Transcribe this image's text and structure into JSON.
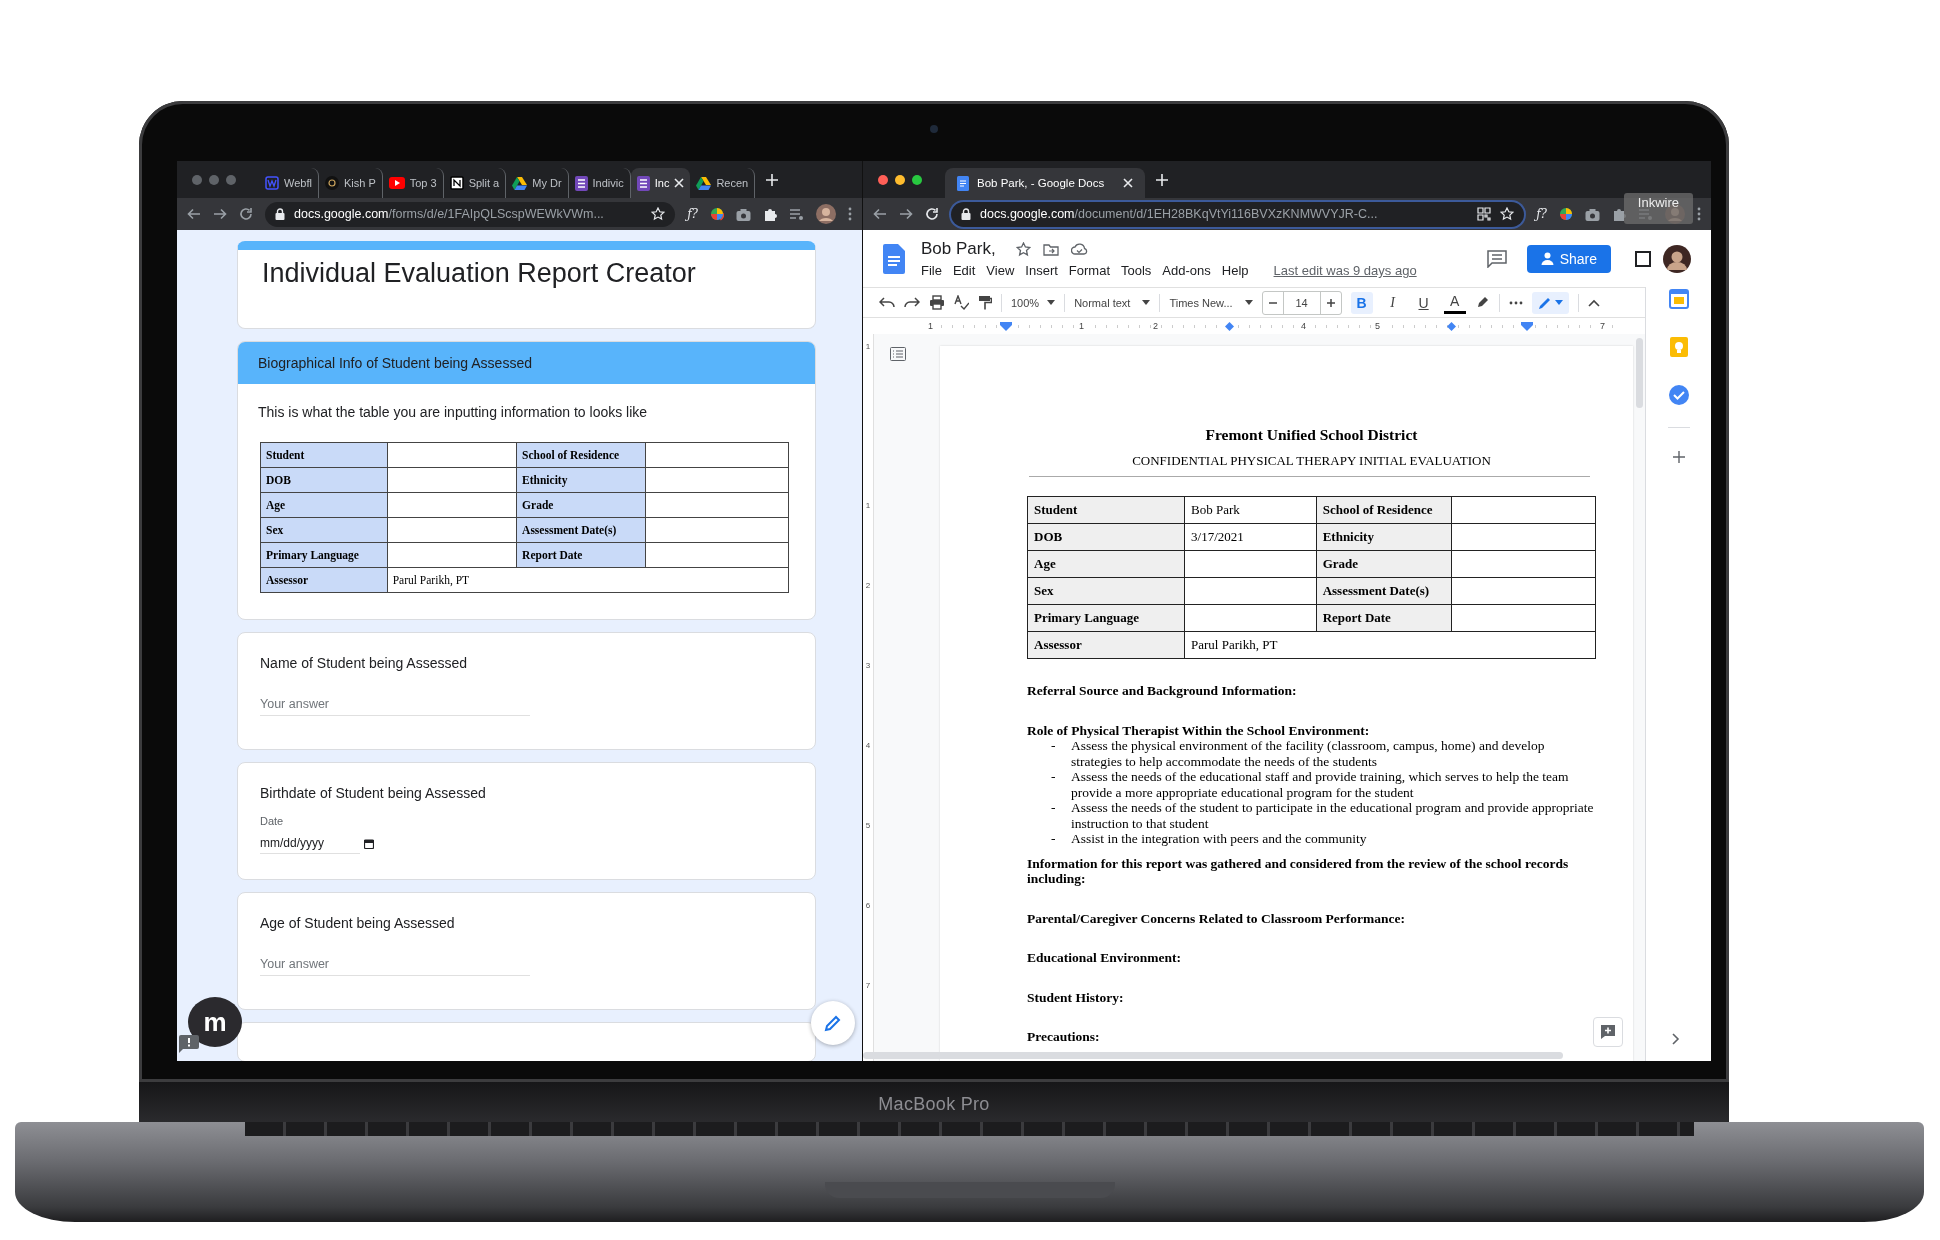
{
  "laptop": {
    "label": "MacBook Pro"
  },
  "left_browser": {
    "tabs": [
      {
        "label": "Webfl",
        "kind": "w",
        "selected": false
      },
      {
        "label": "Kish P",
        "kind": "kp",
        "selected": false
      },
      {
        "label": "Top 3",
        "kind": "youtube",
        "selected": false
      },
      {
        "label": "Split a",
        "kind": "notion",
        "selected": false
      },
      {
        "label": "My Dr",
        "kind": "drive",
        "selected": false
      },
      {
        "label": "Indivic",
        "kind": "forms",
        "selected": false
      },
      {
        "label": "Inc",
        "kind": "forms",
        "selected": true
      },
      {
        "label": "Recen",
        "kind": "drive",
        "selected": false
      }
    ],
    "url_host": "docs.google.com",
    "url_path": "/forms/d/e/1FAIpQLScspWEWkVWm...",
    "extension_label": "ƒ?"
  },
  "form": {
    "title": "Individual Evaluation Report Creator",
    "section_title": "Biographical Info of Student being Assessed",
    "description": "This is what the table you are inputting information to looks like",
    "table": [
      [
        {
          "kind": "head",
          "text": "Student"
        },
        {
          "kind": "value"
        },
        {
          "kind": "head",
          "text": "School of Residence"
        },
        {
          "kind": "value"
        }
      ],
      [
        {
          "kind": "head",
          "text": "DOB"
        },
        {
          "kind": "value"
        },
        {
          "kind": "head",
          "text": "Ethnicity"
        },
        {
          "kind": "value"
        }
      ],
      [
        {
          "kind": "head",
          "text": "Age"
        },
        {
          "kind": "value"
        },
        {
          "kind": "head",
          "text": "Grade"
        },
        {
          "kind": "value"
        }
      ],
      [
        {
          "kind": "head",
          "text": "Sex"
        },
        {
          "kind": "value"
        },
        {
          "kind": "head",
          "text": "Assessment Date(s)"
        },
        {
          "kind": "value"
        }
      ],
      [
        {
          "kind": "head",
          "text": "Primary Language"
        },
        {
          "kind": "value"
        },
        {
          "kind": "head",
          "text": "Report Date"
        },
        {
          "kind": "value"
        }
      ],
      [
        {
          "kind": "head",
          "text": "Assessor"
        },
        {
          "kind": "wide",
          "text": "Parul Parikh, PT"
        }
      ]
    ],
    "questions": [
      {
        "kind": "text",
        "title": "Name of Student being Assessed",
        "placeholder": "Your answer"
      },
      {
        "kind": "date",
        "title": "Birthdate of Student being Assessed",
        "label": "Date",
        "placeholder": "mm/dd/yyyy"
      },
      {
        "kind": "text",
        "title": "Age of Student being Assessed",
        "placeholder": "Your answer"
      }
    ],
    "badge": "m"
  },
  "right_browser": {
    "tabs": [
      {
        "label": "Bob Park, - Google Docs",
        "kind": "docs",
        "selected": true
      }
    ],
    "url_host": "docs.google.com",
    "url_path": "/document/d/1EH28BKqVtYi116BVXzKNMWVYJR-C...",
    "extension_label": "ƒ?",
    "tooltip": "Inkwire"
  },
  "docs": {
    "title": "Bob Park,",
    "menu": [
      "File",
      "Edit",
      "View",
      "Insert",
      "Format",
      "Tools",
      "Add-ons",
      "Help"
    ],
    "last_edit": "Last edit was 9 days ago",
    "share": "Share",
    "toolbar": {
      "zoom": "100%",
      "style": "Normal text",
      "font": "Times New...",
      "size": "14",
      "format_buttons": [
        {
          "kind": "bold",
          "label": "B",
          "selected": true
        },
        {
          "kind": "italic",
          "label": "I",
          "selected": false
        },
        {
          "kind": "underline",
          "label": "U",
          "selected": false
        },
        {
          "kind": "color",
          "label": "A",
          "selected": false
        }
      ]
    },
    "ruler": [
      {
        "kind": "label",
        "text": "1"
      },
      {
        "kind": "indent"
      },
      {
        "kind": "label",
        "text": "1"
      },
      {
        "kind": "label",
        "text": "2"
      },
      {
        "kind": "tab"
      },
      {
        "kind": "label",
        "text": "4"
      },
      {
        "kind": "label",
        "text": "5"
      },
      {
        "kind": "tab"
      },
      {
        "kind": "indent"
      },
      {
        "kind": "label",
        "text": "7"
      }
    ],
    "vertical_ruler": [
      "1",
      "1",
      "2",
      "3",
      "4",
      "5",
      "6",
      "7"
    ],
    "document": {
      "heading": "Fremont Unified School District",
      "subheading": "CONFIDENTIAL PHYSICAL THERAPY INITIAL EVALUATION",
      "table": [
        [
          {
            "kind": "head",
            "text": "Student"
          },
          {
            "kind": "value",
            "text": "Bob Park"
          },
          {
            "kind": "head",
            "text": "School of Residence"
          },
          {
            "kind": "value"
          }
        ],
        [
          {
            "kind": "head",
            "text": "DOB"
          },
          {
            "kind": "value",
            "text": "3/17/2021"
          },
          {
            "kind": "head",
            "text": "Ethnicity"
          },
          {
            "kind": "value"
          }
        ],
        [
          {
            "kind": "head",
            "text": "Age"
          },
          {
            "kind": "value"
          },
          {
            "kind": "head",
            "text": "Grade"
          },
          {
            "kind": "value"
          }
        ],
        [
          {
            "kind": "head",
            "text": "Sex"
          },
          {
            "kind": "value"
          },
          {
            "kind": "head",
            "text": "Assessment Date(s)"
          },
          {
            "kind": "value"
          }
        ],
        [
          {
            "kind": "head",
            "text": "Primary Language"
          },
          {
            "kind": "value"
          },
          {
            "kind": "head",
            "text": "Report Date"
          },
          {
            "kind": "value"
          }
        ],
        [
          {
            "kind": "head",
            "text": "Assessor"
          },
          {
            "kind": "wide",
            "text": "Parul Parikh, PT"
          }
        ]
      ],
      "sections": [
        {
          "heading": "Referral Source and Background Information:"
        },
        {
          "heading": "Role of Physical Therapist Within the School Environment:",
          "bullets": [
            {
              "marker": "-",
              "text": "Assess the physical environment of the facility (classroom, campus, home) and develop strategies to help accommodate the needs of the students"
            },
            {
              "marker": "-",
              "text": "Assess the needs of the educational staff and provide training, which serves to help the team provide a more appropriate educational program for the student"
            },
            {
              "marker": "-",
              "text": "Assess the needs of the student to participate in the educational program and provide appropriate instruction to that student"
            },
            {
              "marker": "-",
              "text": "Assist in the integration with peers and the community"
            }
          ]
        },
        {
          "heading": "Information for this report was gathered and considered from the review of the school records including:"
        },
        {
          "heading": "Parental/Caregiver Concerns Related to Classroom Performance:"
        },
        {
          "heading": "Educational Environment:"
        },
        {
          "heading": "Student History:"
        },
        {
          "heading": "Precautions:"
        }
      ]
    }
  }
}
